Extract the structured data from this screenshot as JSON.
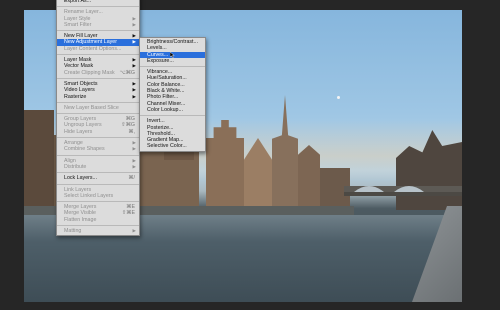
{
  "layer_menu": {
    "items": [
      {
        "label": "Export As...",
        "shortcut": "",
        "state": "normal",
        "arrow": false
      },
      {
        "type": "sep"
      },
      {
        "label": "Rename Layer...",
        "shortcut": "",
        "state": "disabled",
        "arrow": false
      },
      {
        "label": "Layer Style",
        "shortcut": "",
        "state": "disabled",
        "arrow": true
      },
      {
        "label": "Smart Filter",
        "shortcut": "",
        "state": "disabled",
        "arrow": true
      },
      {
        "type": "sep"
      },
      {
        "label": "New Fill Layer",
        "shortcut": "",
        "state": "normal",
        "arrow": true
      },
      {
        "label": "New Adjustment Layer",
        "shortcut": "",
        "state": "selected",
        "arrow": true
      },
      {
        "label": "Layer Content Options...",
        "shortcut": "",
        "state": "disabled",
        "arrow": false
      },
      {
        "type": "sep"
      },
      {
        "label": "Layer Mask",
        "shortcut": "",
        "state": "normal",
        "arrow": true
      },
      {
        "label": "Vector Mask",
        "shortcut": "",
        "state": "normal",
        "arrow": true
      },
      {
        "label": "Create Clipping Mask",
        "shortcut": "⌥⌘G",
        "state": "disabled",
        "arrow": false
      },
      {
        "type": "sep"
      },
      {
        "label": "Smart Objects",
        "shortcut": "",
        "state": "normal",
        "arrow": true
      },
      {
        "label": "Video Layers",
        "shortcut": "",
        "state": "normal",
        "arrow": true
      },
      {
        "label": "Rasterize",
        "shortcut": "",
        "state": "normal",
        "arrow": true
      },
      {
        "type": "sep"
      },
      {
        "label": "New Layer Based Slice",
        "shortcut": "",
        "state": "disabled",
        "arrow": false
      },
      {
        "type": "sep"
      },
      {
        "label": "Group Layers",
        "shortcut": "⌘G",
        "state": "disabled",
        "arrow": false
      },
      {
        "label": "Ungroup Layers",
        "shortcut": "⇧⌘G",
        "state": "disabled",
        "arrow": false
      },
      {
        "label": "Hide Layers",
        "shortcut": "⌘,",
        "state": "disabled",
        "arrow": false
      },
      {
        "type": "sep"
      },
      {
        "label": "Arrange",
        "shortcut": "",
        "state": "disabled",
        "arrow": true
      },
      {
        "label": "Combine Shapes",
        "shortcut": "",
        "state": "disabled",
        "arrow": true
      },
      {
        "type": "sep"
      },
      {
        "label": "Align",
        "shortcut": "",
        "state": "disabled",
        "arrow": true
      },
      {
        "label": "Distribute",
        "shortcut": "",
        "state": "disabled",
        "arrow": true
      },
      {
        "type": "sep"
      },
      {
        "label": "Lock Layers...",
        "shortcut": "⌘/",
        "state": "normal",
        "arrow": false
      },
      {
        "type": "sep"
      },
      {
        "label": "Link Layers",
        "shortcut": "",
        "state": "disabled",
        "arrow": false
      },
      {
        "label": "Select Linked Layers",
        "shortcut": "",
        "state": "disabled",
        "arrow": false
      },
      {
        "type": "sep"
      },
      {
        "label": "Merge Layers",
        "shortcut": "⌘E",
        "state": "disabled",
        "arrow": false
      },
      {
        "label": "Merge Visible",
        "shortcut": "⇧⌘E",
        "state": "disabled",
        "arrow": false
      },
      {
        "label": "Flatten Image",
        "shortcut": "",
        "state": "disabled",
        "arrow": false
      },
      {
        "type": "sep"
      },
      {
        "label": "Matting",
        "shortcut": "",
        "state": "disabled",
        "arrow": true
      }
    ]
  },
  "adjustment_submenu": {
    "items": [
      {
        "label": "Brightness/Contrast...",
        "state": "normal"
      },
      {
        "label": "Levels...",
        "state": "normal"
      },
      {
        "label": "Curves...",
        "state": "selected"
      },
      {
        "label": "Exposure...",
        "state": "normal"
      },
      {
        "type": "sep"
      },
      {
        "label": "Vibrance...",
        "state": "normal"
      },
      {
        "label": "Hue/Saturation...",
        "state": "normal"
      },
      {
        "label": "Color Balance...",
        "state": "normal"
      },
      {
        "label": "Black & White...",
        "state": "normal"
      },
      {
        "label": "Photo Filter...",
        "state": "normal"
      },
      {
        "label": "Channel Mixer...",
        "state": "normal"
      },
      {
        "label": "Color Lookup...",
        "state": "normal"
      },
      {
        "type": "sep"
      },
      {
        "label": "Invert...",
        "state": "normal"
      },
      {
        "label": "Posterize...",
        "state": "normal"
      },
      {
        "label": "Threshold...",
        "state": "normal"
      },
      {
        "label": "Gradient Map...",
        "state": "normal"
      },
      {
        "label": "Selective Color...",
        "state": "normal"
      }
    ]
  },
  "colors": {
    "highlight": "#2a6fdc",
    "menu_bg": "#dcdcdc",
    "app_bg": "#262626"
  }
}
